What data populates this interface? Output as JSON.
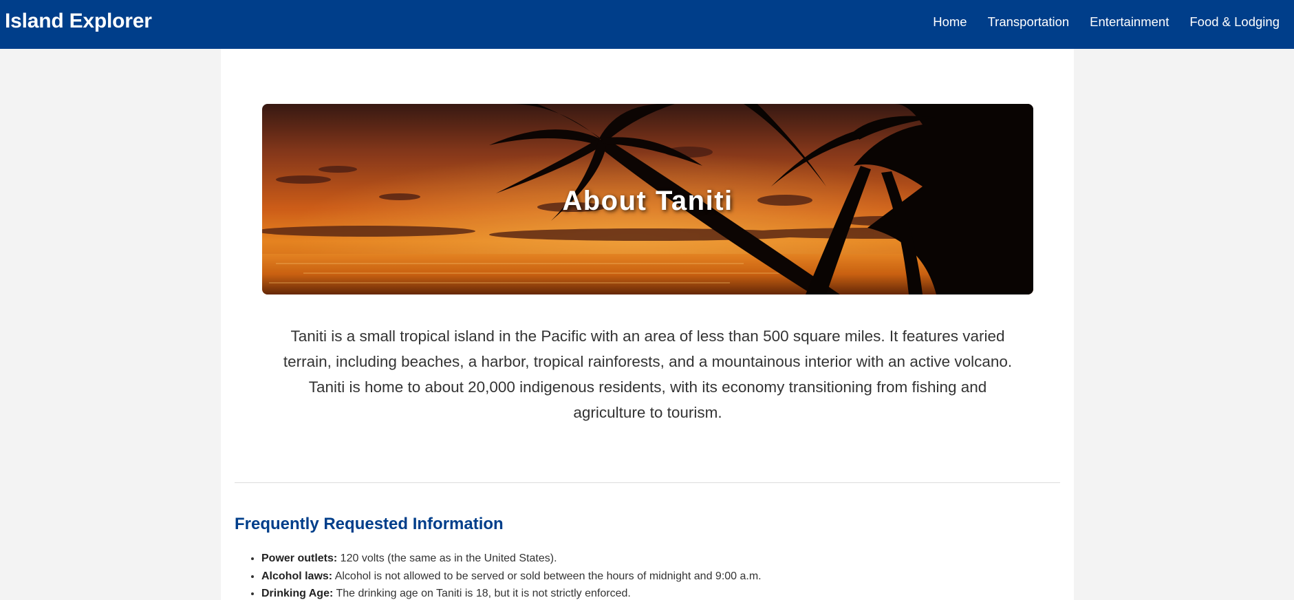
{
  "header": {
    "brand": "Island Explorer",
    "nav": [
      "Home",
      "Transportation",
      "Entertainment",
      "Food & Lodging"
    ]
  },
  "hero": {
    "title": "About Taniti",
    "image_description": "sunset-palm-beach-image"
  },
  "intro": "Taniti is a small tropical island in the Pacific with an area of less than 500 square miles. It features varied terrain, including beaches, a harbor, tropical rainforests, and a mountainous interior with an active volcano. Taniti is home to about 20,000 indigenous residents, with its economy transitioning from fishing and agriculture to tourism.",
  "faq": {
    "title": "Frequently Requested Information",
    "items": [
      {
        "label": "Power outlets:",
        "text": " 120 volts (the same as in the United States)."
      },
      {
        "label": "Alcohol laws:",
        "text": " Alcohol is not allowed to be served or sold between the hours of midnight and 9:00 a.m."
      },
      {
        "label": "Drinking Age:",
        "text": " The drinking age on Taniti is 18, but it is not strictly enforced."
      }
    ]
  },
  "colors": {
    "header_bg": "#003e8a",
    "faq_title": "#003e8a",
    "page_bg": "#f3f3f3"
  }
}
